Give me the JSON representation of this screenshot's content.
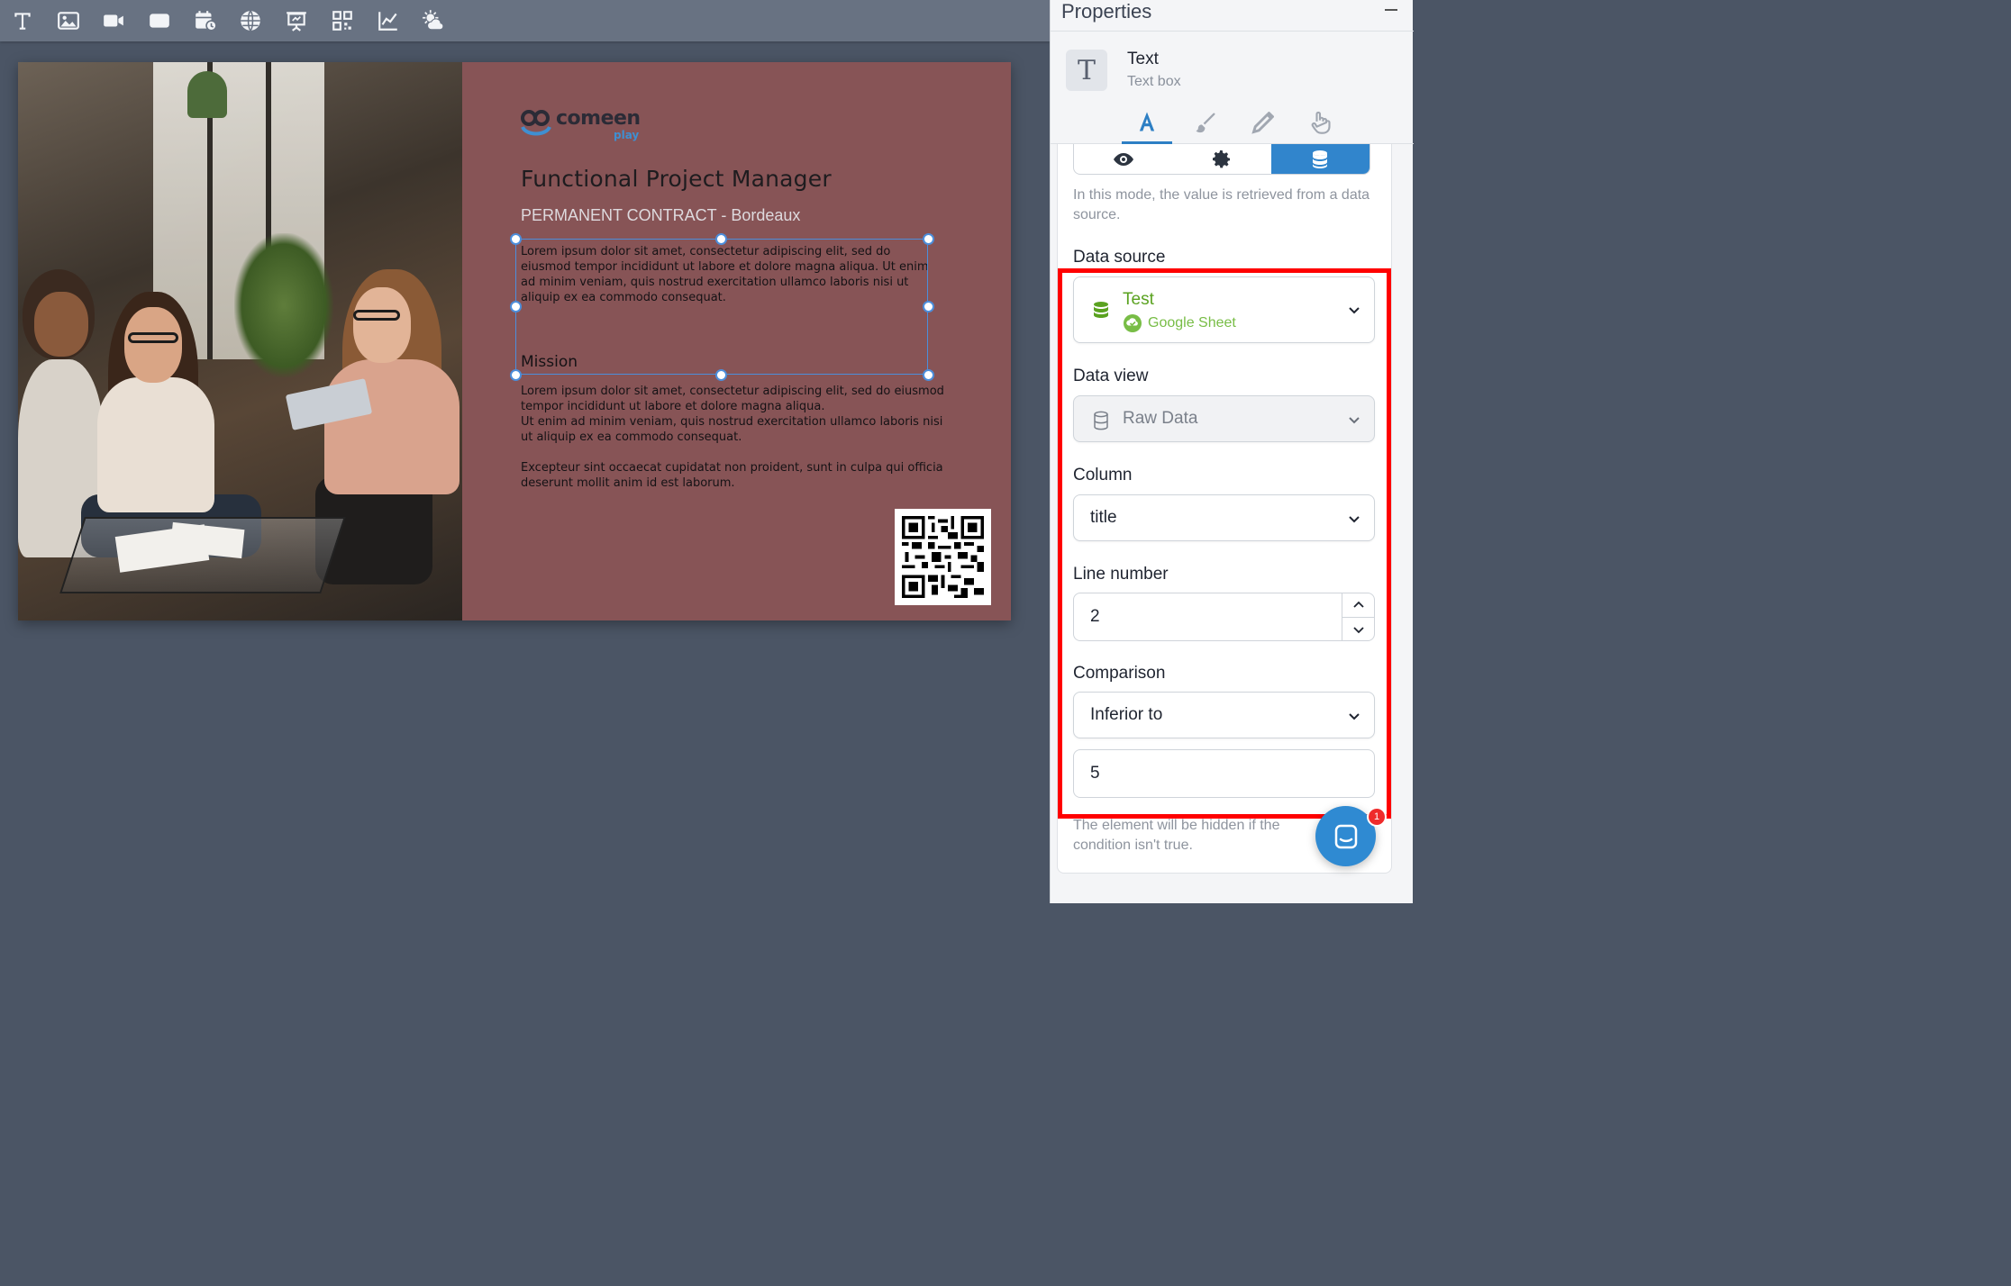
{
  "toolbar": {
    "tools": [
      "text-tool-icon",
      "image-tool-icon",
      "video-tool-icon",
      "shape-tool-icon",
      "calendar-tool-icon",
      "web-tool-icon",
      "presentation-tool-icon",
      "qrcode-tool-icon",
      "chart-tool-icon",
      "weather-tool-icon"
    ]
  },
  "slide": {
    "logo_text": "comeen",
    "logo_sub": "play",
    "title": "Functional Project Manager",
    "subtitle": "PERMANENT CONTRACT - Bordeaux",
    "body_1": "Lorem ipsum dolor sit amet, consectetur adipiscing elit, sed do eiusmod tempor incididunt ut labore et dolore magna aliqua. Ut enim ad minim veniam, quis nostrud exercitation ullamco laboris nisi ut aliquip ex ea commodo consequat.",
    "mission_heading": "Mission",
    "body_2": "Lorem ipsum dolor sit amet, consectetur adipiscing elit, sed do eiusmod tempor incididunt ut labore et dolore magna aliqua.\nUt enim ad minim veniam, quis nostrud exercitation ullamco laboris nisi ut aliquip ex ea commodo consequat.\n\nExcepteur sint occaecat cupidatat non proident, sunt in culpa qui officia deserunt mollit anim id est laborum."
  },
  "properties": {
    "title": "Properties",
    "element_type": "Text",
    "element_desc": "Text box",
    "mode_help": "In this mode, the value is retrieved from a data source.",
    "data_source": {
      "label": "Data source",
      "value": "Test",
      "provider": "Google Sheet"
    },
    "data_view": {
      "label": "Data view",
      "value": "Raw Data"
    },
    "column": {
      "label": "Column",
      "value": "title"
    },
    "line_number": {
      "label": "Line number",
      "value": "2"
    },
    "comparison": {
      "label": "Comparison",
      "operator": "Inferior to",
      "value": "5"
    },
    "hint": "The element will be hidden if the condition isn't true."
  },
  "colors": {
    "accent": "#3185cc",
    "highlight": "#ff0000",
    "slide_panel": "#875456",
    "source_green": "#5aa220"
  },
  "chat": {
    "badge": "1"
  }
}
